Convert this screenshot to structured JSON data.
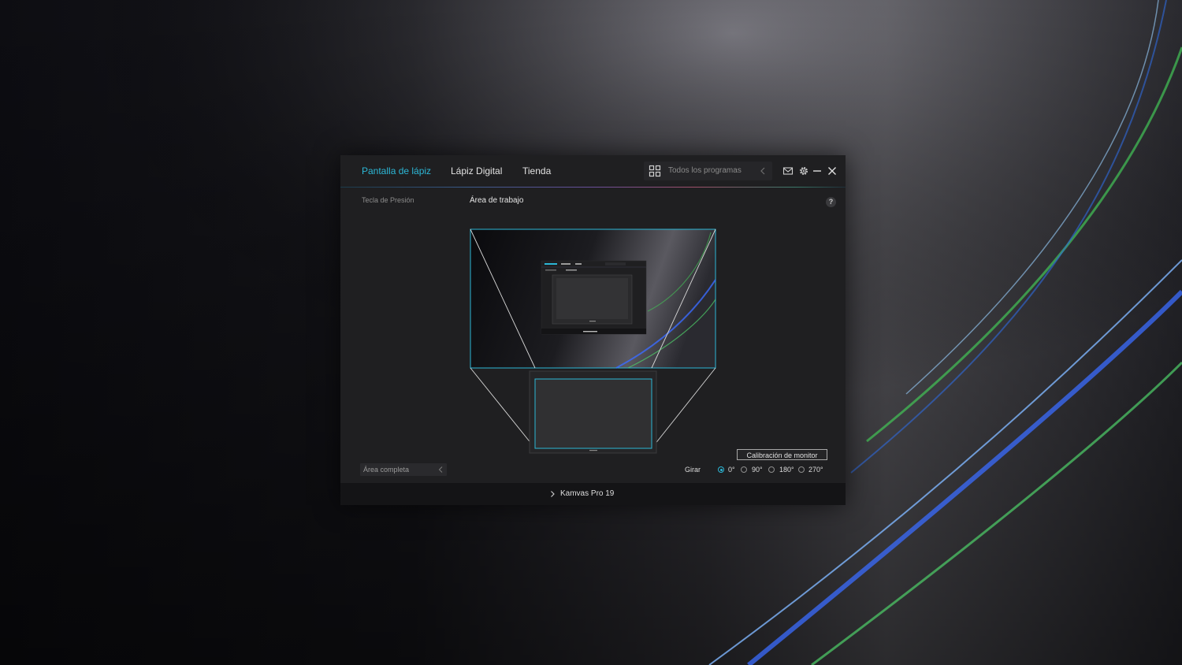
{
  "window": {
    "tabs": [
      {
        "label": "Pantalla de lápiz",
        "active": true
      },
      {
        "label": "Lápiz Digital",
        "active": false
      },
      {
        "label": "Tienda",
        "active": false
      }
    ],
    "programs_selector": {
      "label": "Todos los programas",
      "icon": "grid-icon"
    },
    "icons": [
      "mail-icon",
      "gear-icon",
      "minimize-icon",
      "close-icon"
    ]
  },
  "sidebar": {
    "items": [
      {
        "label": "Tecla de Presión"
      }
    ]
  },
  "main": {
    "section_title": "Área de trabajo",
    "help_label": "?",
    "area_dropdown": {
      "value": "Área completa"
    },
    "calibration_button": "Calibración de monitor",
    "rotate": {
      "label": "Girar",
      "options": [
        "0°",
        "90°",
        "180°",
        "270°"
      ],
      "selected": "0°"
    }
  },
  "footer": {
    "device_name": "Kamvas Pro 19"
  },
  "colors": {
    "accent": "#2cb7d6",
    "window_bg": "#1f1f21",
    "footer_bg": "#141416"
  }
}
